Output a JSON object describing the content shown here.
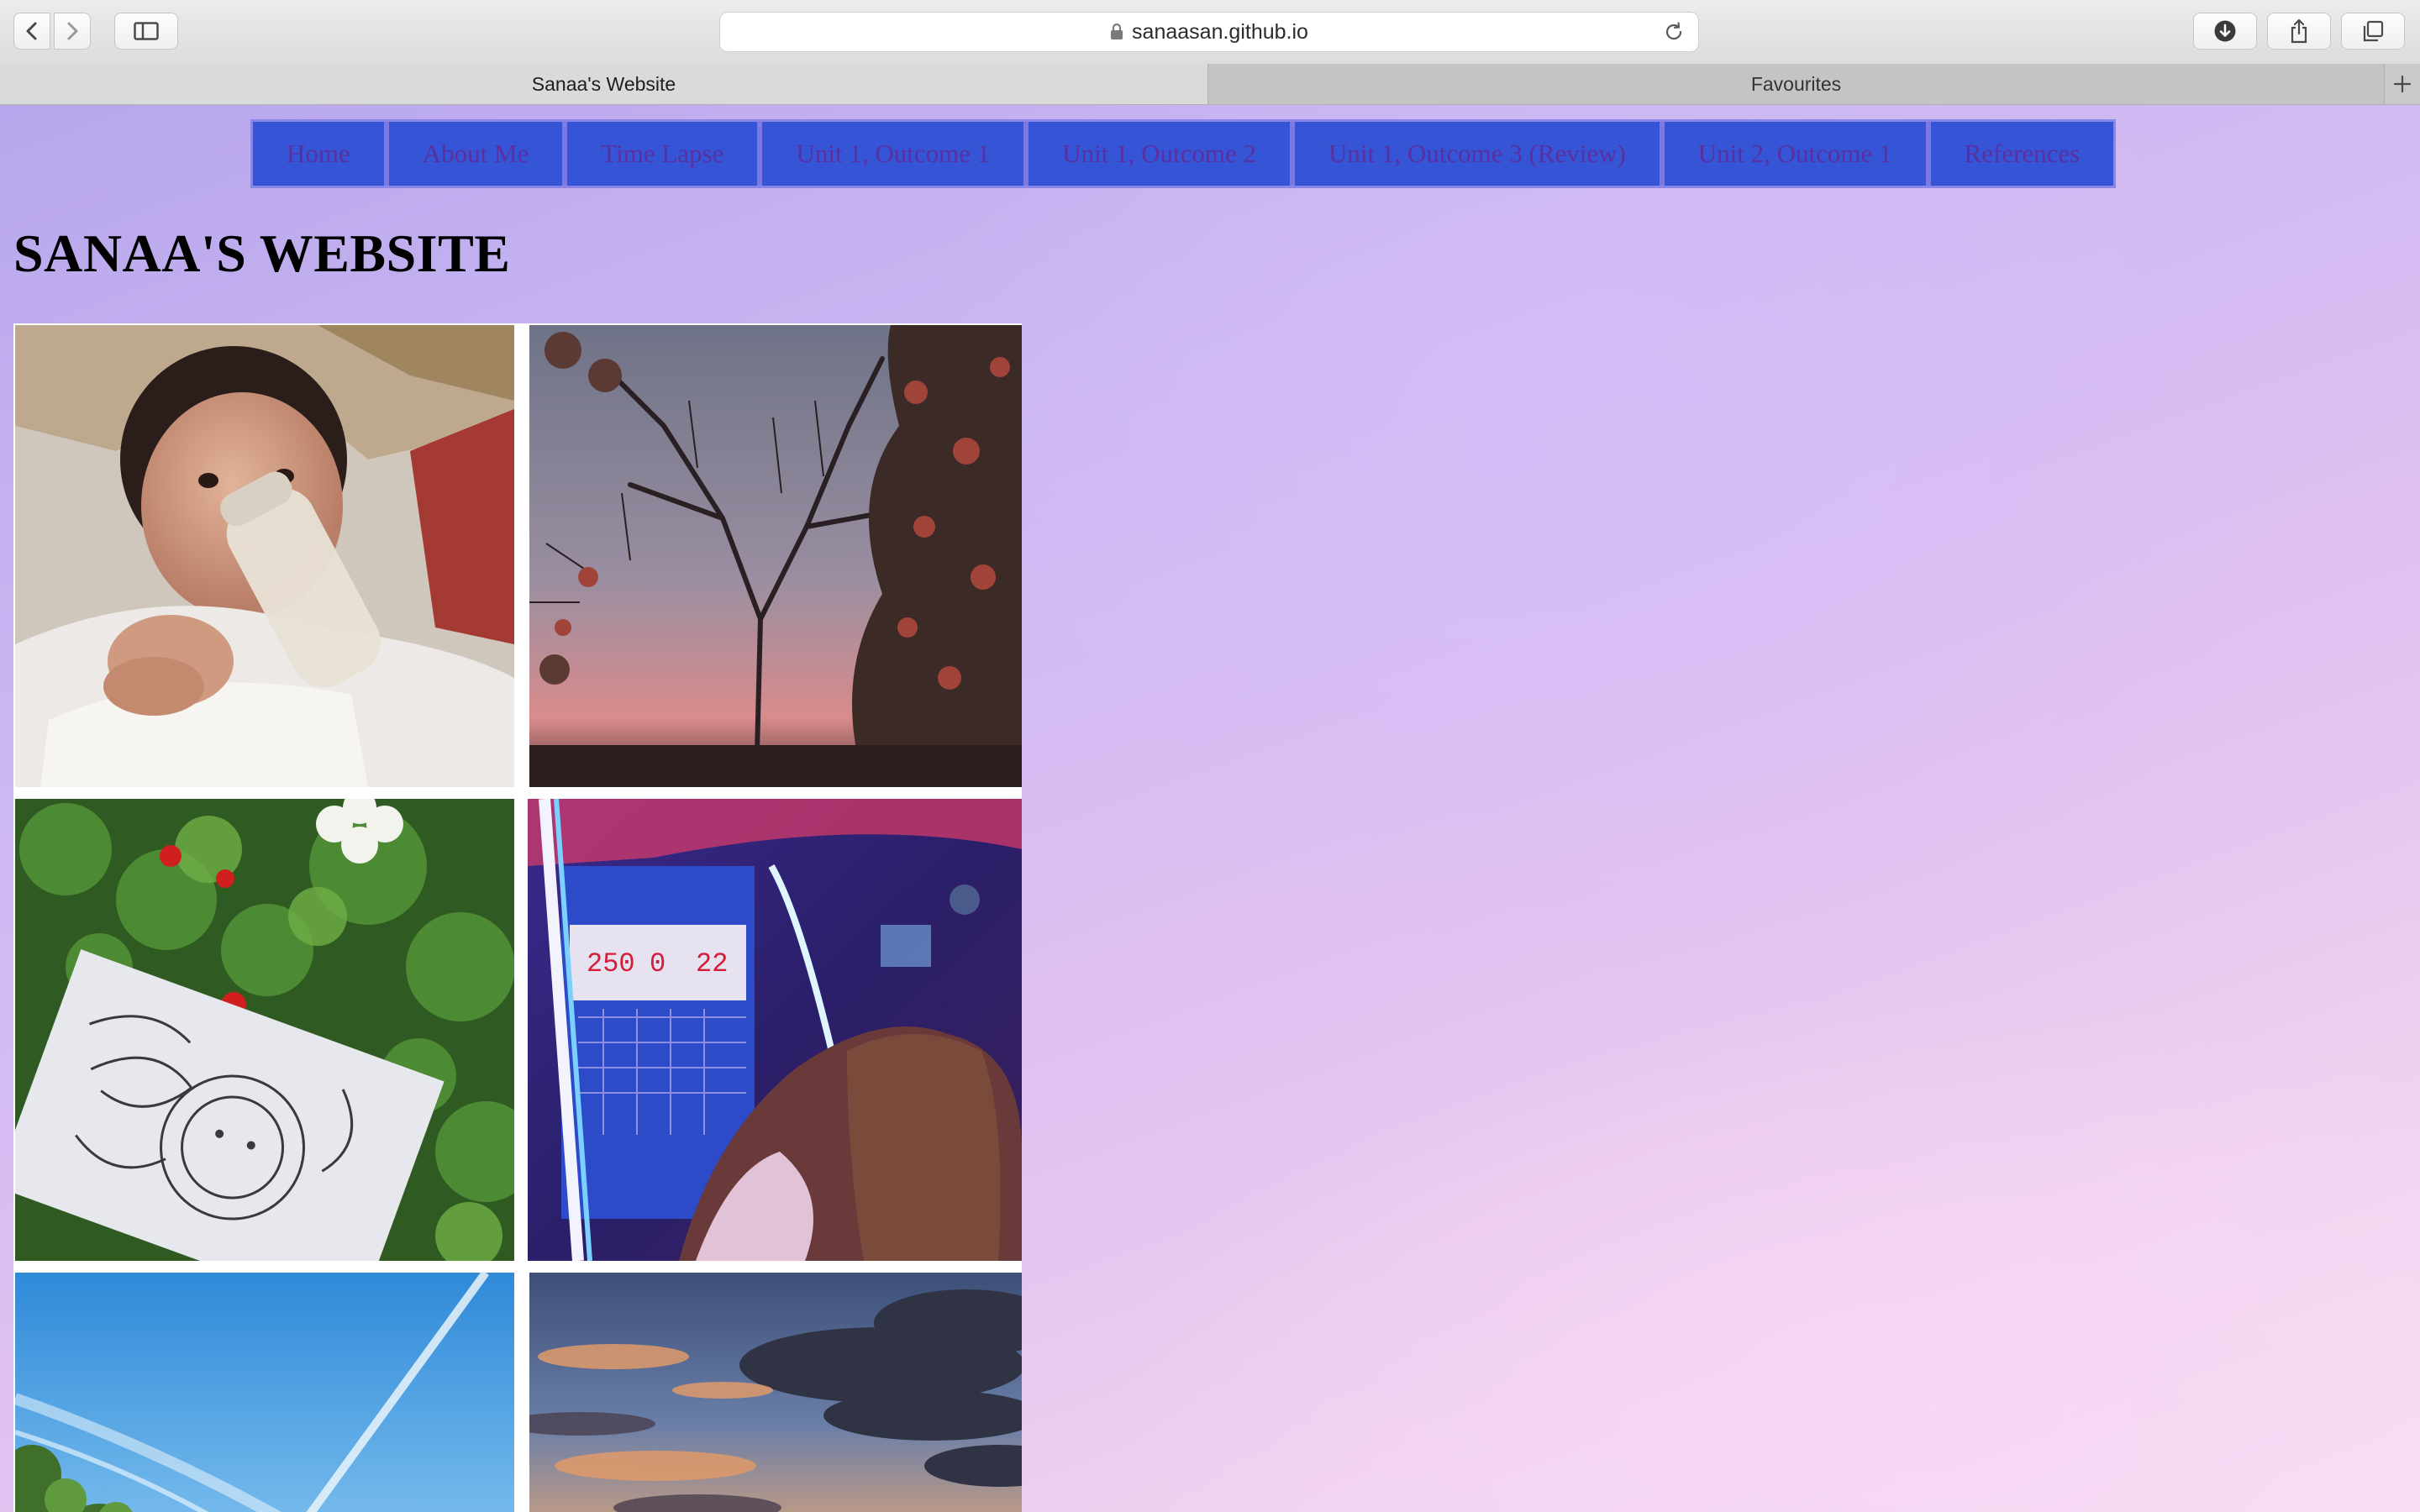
{
  "browser": {
    "url": "sanaasan.github.io",
    "tabs": [
      {
        "label": "Sanaa's Website",
        "active": true
      },
      {
        "label": "Favourites",
        "active": false
      }
    ],
    "icons": [
      "back-icon",
      "forward-icon",
      "sidebar-icon",
      "lock-icon",
      "reload-icon",
      "download-icon",
      "share-icon",
      "tabs-overview-icon",
      "new-tab-icon"
    ]
  },
  "nav": {
    "items": [
      {
        "label": "Home"
      },
      {
        "label": "About Me"
      },
      {
        "label": "Time Lapse"
      },
      {
        "label": "Unit 1, Outcome 1"
      },
      {
        "label": "Unit 1, Outcome 2"
      },
      {
        "label": "Unit 1, Outcome 3 (Review)"
      },
      {
        "label": "Unit 2, Outcome 1"
      },
      {
        "label": "References"
      }
    ],
    "colors": {
      "button_bg": "#3554d6",
      "text": "#5a2fa0",
      "border": "#7d79e0"
    }
  },
  "page": {
    "title": "SANAA'S WEBSITE",
    "gallery": [
      {
        "name": "baby-bottle-photo"
      },
      {
        "name": "tree-sunset-photo"
      },
      {
        "name": "mandala-drawing-photo"
      },
      {
        "name": "arcade-basketball-photo"
      },
      {
        "name": "sky-contrails-photo"
      },
      {
        "name": "cloudy-sunset-photo"
      }
    ],
    "arcade_scoreboard": {
      "left": "250",
      "middle": "0",
      "right": "22"
    }
  }
}
